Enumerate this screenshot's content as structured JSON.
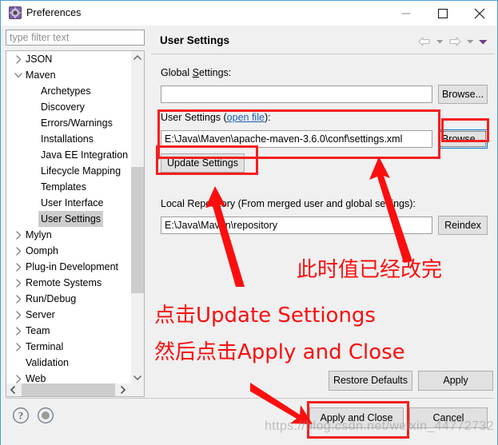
{
  "window": {
    "title": "Preferences",
    "icon": "preferences-icon",
    "minimize_label": "Minimize",
    "maximize_label": "Maximize",
    "close_label": "Close"
  },
  "sidebar": {
    "filter_placeholder": "type filter text",
    "filter_value": "",
    "items": [
      {
        "label": "JSON",
        "depth": 0,
        "expandable": true,
        "expanded": false,
        "selected": false
      },
      {
        "label": "Maven",
        "depth": 0,
        "expandable": true,
        "expanded": true,
        "selected": false
      },
      {
        "label": "Archetypes",
        "depth": 1,
        "expandable": false,
        "expanded": false,
        "selected": false
      },
      {
        "label": "Discovery",
        "depth": 1,
        "expandable": false,
        "expanded": false,
        "selected": false
      },
      {
        "label": "Errors/Warnings",
        "depth": 1,
        "expandable": false,
        "expanded": false,
        "selected": false
      },
      {
        "label": "Installations",
        "depth": 1,
        "expandable": false,
        "expanded": false,
        "selected": false
      },
      {
        "label": "Java EE Integration",
        "depth": 1,
        "expandable": false,
        "expanded": false,
        "selected": false
      },
      {
        "label": "Lifecycle Mapping",
        "depth": 1,
        "expandable": false,
        "expanded": false,
        "selected": false
      },
      {
        "label": "Templates",
        "depth": 1,
        "expandable": false,
        "expanded": false,
        "selected": false
      },
      {
        "label": "User Interface",
        "depth": 1,
        "expandable": false,
        "expanded": false,
        "selected": false
      },
      {
        "label": "User Settings",
        "depth": 1,
        "expandable": false,
        "expanded": false,
        "selected": true
      },
      {
        "label": "Mylyn",
        "depth": 0,
        "expandable": true,
        "expanded": false,
        "selected": false
      },
      {
        "label": "Oomph",
        "depth": 0,
        "expandable": true,
        "expanded": false,
        "selected": false
      },
      {
        "label": "Plug-in Development",
        "depth": 0,
        "expandable": true,
        "expanded": false,
        "selected": false
      },
      {
        "label": "Remote Systems",
        "depth": 0,
        "expandable": true,
        "expanded": false,
        "selected": false
      },
      {
        "label": "Run/Debug",
        "depth": 0,
        "expandable": true,
        "expanded": false,
        "selected": false
      },
      {
        "label": "Server",
        "depth": 0,
        "expandable": true,
        "expanded": false,
        "selected": false
      },
      {
        "label": "Team",
        "depth": 0,
        "expandable": true,
        "expanded": false,
        "selected": false
      },
      {
        "label": "Terminal",
        "depth": 0,
        "expandable": true,
        "expanded": false,
        "selected": false
      },
      {
        "label": "Validation",
        "depth": 0,
        "expandable": false,
        "expanded": false,
        "selected": false
      },
      {
        "label": "Web",
        "depth": 0,
        "expandable": true,
        "expanded": false,
        "selected": false
      }
    ]
  },
  "page": {
    "title": "User Settings",
    "nav": {
      "back": "back-arrow-icon",
      "back_menu": "back-dropdown-icon",
      "forward": "forward-arrow-icon",
      "forward_menu": "forward-dropdown-icon",
      "view_menu": "view-menu-icon"
    },
    "global_settings": {
      "label": "Global Settings:",
      "value": "",
      "browse_label": "Browse..."
    },
    "user_settings": {
      "label_prefix": "User Settings (",
      "link": "open file",
      "label_suffix": "):",
      "value": "E:\\Java\\Maven\\apache-maven-3.6.0\\conf\\settings.xml",
      "browse_label": "Browse...",
      "update_label": "Update Settings"
    },
    "local_repository": {
      "label": "Local Repository (From merged user and global settings):",
      "value": "E:\\Java\\Maven\\repository",
      "reindex_label": "Reindex"
    },
    "restore_defaults_label": "Restore Defaults",
    "apply_label": "Apply"
  },
  "footer": {
    "help_icon": "help-icon",
    "info_icon": "info-icon",
    "apply_and_close_label": "Apply and Close",
    "cancel_label": "Cancel"
  },
  "annotations": {
    "note_value_changed": "此时值已经改完",
    "note_click_update": "点击Update Settiongs",
    "note_then_apply": "然后点击Apply and Close",
    "color": "#fb0e0e",
    "watermark": "https://blog.csdn.net/weixin_44772732"
  }
}
